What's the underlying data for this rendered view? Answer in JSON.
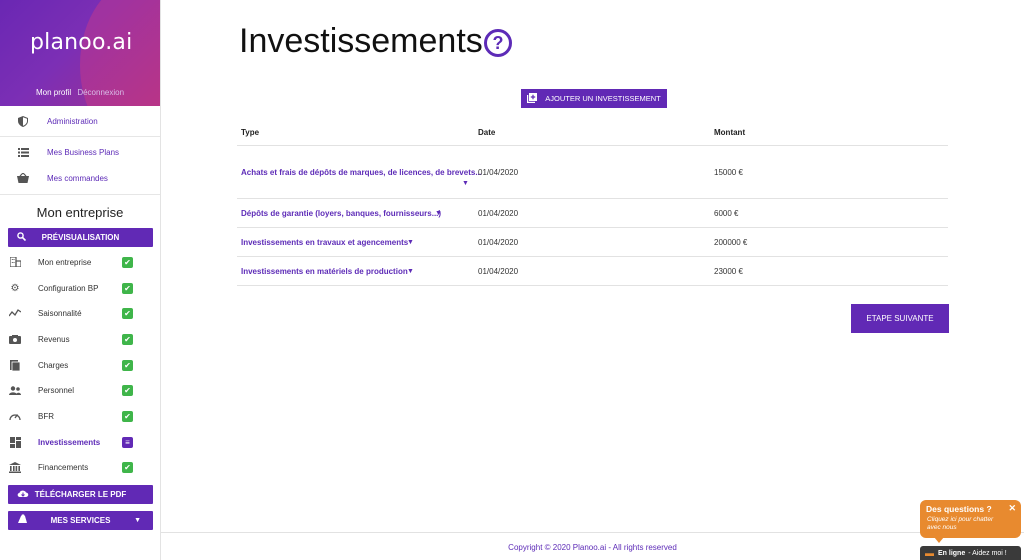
{
  "brand": {
    "logo": "planoo.ai",
    "my_profile": "Mon profil",
    "logout": "Déconnexion"
  },
  "sidebar": {
    "admin": "Administration",
    "business_plans": "Mes Business Plans",
    "orders": "Mes commandes",
    "section_title": "Mon entreprise",
    "preview_btn": "Prévisualisation",
    "steps": [
      {
        "label": "Mon entreprise",
        "icon": "building-icon",
        "status": "done"
      },
      {
        "label": "Configuration BP",
        "icon": "gear-icon",
        "status": "done"
      },
      {
        "label": "Saisonnalité",
        "icon": "trend-icon",
        "status": "done"
      },
      {
        "label": "Revenus",
        "icon": "cash-icon",
        "status": "done"
      },
      {
        "label": "Charges",
        "icon": "book-icon",
        "status": "done"
      },
      {
        "label": "Personnel",
        "icon": "people-icon",
        "status": "done"
      },
      {
        "label": "BFR",
        "icon": "gauge-icon",
        "status": "done"
      },
      {
        "label": "Investissements",
        "icon": "dashboard-icon",
        "status": "current"
      },
      {
        "label": "Financements",
        "icon": "bank-icon",
        "status": "done"
      }
    ],
    "download_btn": "Télécharger le PDF",
    "services_btn": "Mes services"
  },
  "main": {
    "title": "Investissements",
    "add_btn": "Ajouter un investissement",
    "columns": {
      "type": "Type",
      "date": "Date",
      "amount": "Montant"
    },
    "rows": [
      {
        "type": "Achats et frais de dépôts de marques, de licences, de brevets...",
        "date": "01/04/2020",
        "amount": "15000 €"
      },
      {
        "type": "Dépôts de garantie (loyers, banques, fournisseurs...)",
        "date": "01/04/2020",
        "amount": "6000 €"
      },
      {
        "type": "Investissements en travaux et agencements",
        "date": "01/04/2020",
        "amount": "200000 €"
      },
      {
        "type": "Investissements en matériels de production",
        "date": "01/04/2020",
        "amount": "23000 €"
      }
    ],
    "next_btn": "Etape suivante",
    "footer": "Copyright © 2020 Planoo.ai - All rights reserved"
  },
  "chat": {
    "question": "Des questions ?",
    "subtitle": "Cliquez ici pour chatter avec nous",
    "status": "En ligne",
    "help": "- Aidez moi !"
  },
  "colors": {
    "accent": "#6129b5",
    "check": "#3fb54a",
    "chat": "#e88a2f"
  }
}
